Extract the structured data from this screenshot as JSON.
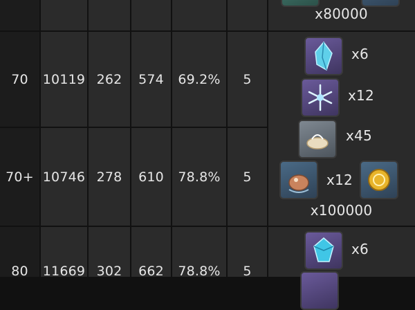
{
  "colors": {
    "background": "#111111",
    "level_cell": "#1c1c1c",
    "stat_cell": "#2b2b2b",
    "material_cell": "#2a2a2a",
    "text": "#e6e6e6"
  },
  "top_row": {
    "mora_amount": "x80000"
  },
  "rows": [
    {
      "level": "70",
      "hp": "10119",
      "atk": "262",
      "def": "574",
      "stat": "69.2%",
      "skill": "5",
      "materials": [
        {
          "icon": "blue-crystal-chunk-icon",
          "qty": "x6"
        },
        {
          "icon": "ice-crystal-flower-icon",
          "qty": "x12"
        },
        {
          "icon": "nectar-bag-icon",
          "qty": "x45"
        },
        {
          "icon": "bird-statue-icon",
          "qty": "x12"
        },
        {
          "icon": "mora-coin-icon",
          "qty": ""
        }
      ],
      "mora": "x100000"
    },
    {
      "level": "70+",
      "hp": "10746",
      "atk": "278",
      "def": "610",
      "stat": "78.8%",
      "skill": "5"
    },
    {
      "level": "80",
      "hp": "11669",
      "atk": "302",
      "def": "662",
      "stat": "78.8%",
      "skill": "5",
      "materials": [
        {
          "icon": "blue-gemstone-icon",
          "qty": "x6"
        }
      ]
    }
  ]
}
